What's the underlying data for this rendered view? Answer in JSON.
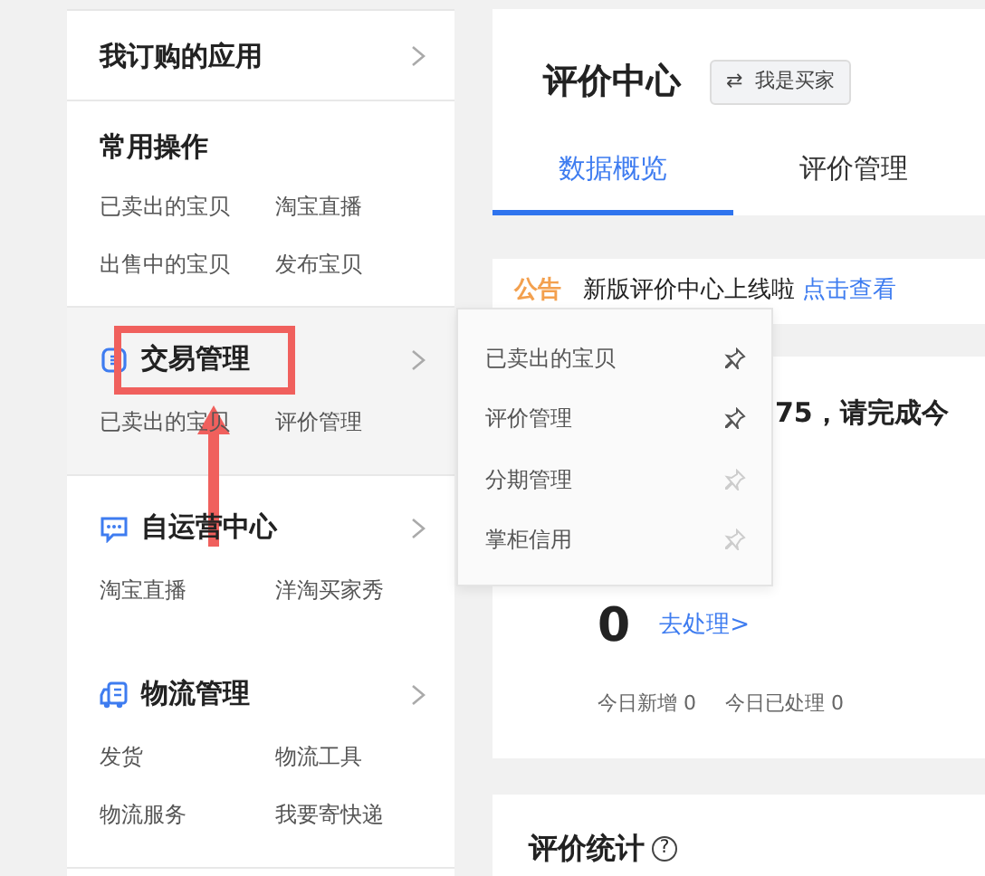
{
  "sidebar": {
    "sections": [
      {
        "kind": "link",
        "title": "我订购的应用"
      },
      {
        "kind": "plain",
        "title": "常用操作",
        "links": [
          "已卖出的宝贝",
          "淘宝直播",
          "出售中的宝贝",
          "发布宝贝"
        ]
      },
      {
        "kind": "group",
        "title": "交易管理",
        "hovered": true,
        "links": [
          "已卖出的宝贝",
          "评价管理"
        ]
      },
      {
        "kind": "group",
        "title": "自运营中心",
        "links": [
          "淘宝直播",
          "洋淘买家秀"
        ]
      },
      {
        "kind": "group",
        "title": "物流管理",
        "links": [
          "发货",
          "物流工具",
          "物流服务",
          "我要寄快递"
        ]
      }
    ]
  },
  "flyout": {
    "items": [
      {
        "label": "已卖出的宝贝",
        "pinned": true
      },
      {
        "label": "评价管理",
        "pinned": true
      },
      {
        "label": "分期管理",
        "pinned": false
      },
      {
        "label": "掌柜信用",
        "pinned": false
      }
    ]
  },
  "main": {
    "title": "评价中心",
    "switch_button": "我是买家",
    "switch_icon": "⇄",
    "tabs": [
      {
        "label": "数据概览",
        "selected": true
      },
      {
        "label": "评价管理",
        "selected": false
      }
    ],
    "notice": {
      "tag": "公告",
      "text": "新版评价中心上线啦",
      "link": "点击查看"
    },
    "pending": {
      "message": "75，请完成今",
      "count": "0",
      "action": "去处理>",
      "stats": [
        "今日新增 0",
        "今日已处理 0"
      ]
    },
    "stats_title": "评价统计",
    "help_icon": "?"
  }
}
